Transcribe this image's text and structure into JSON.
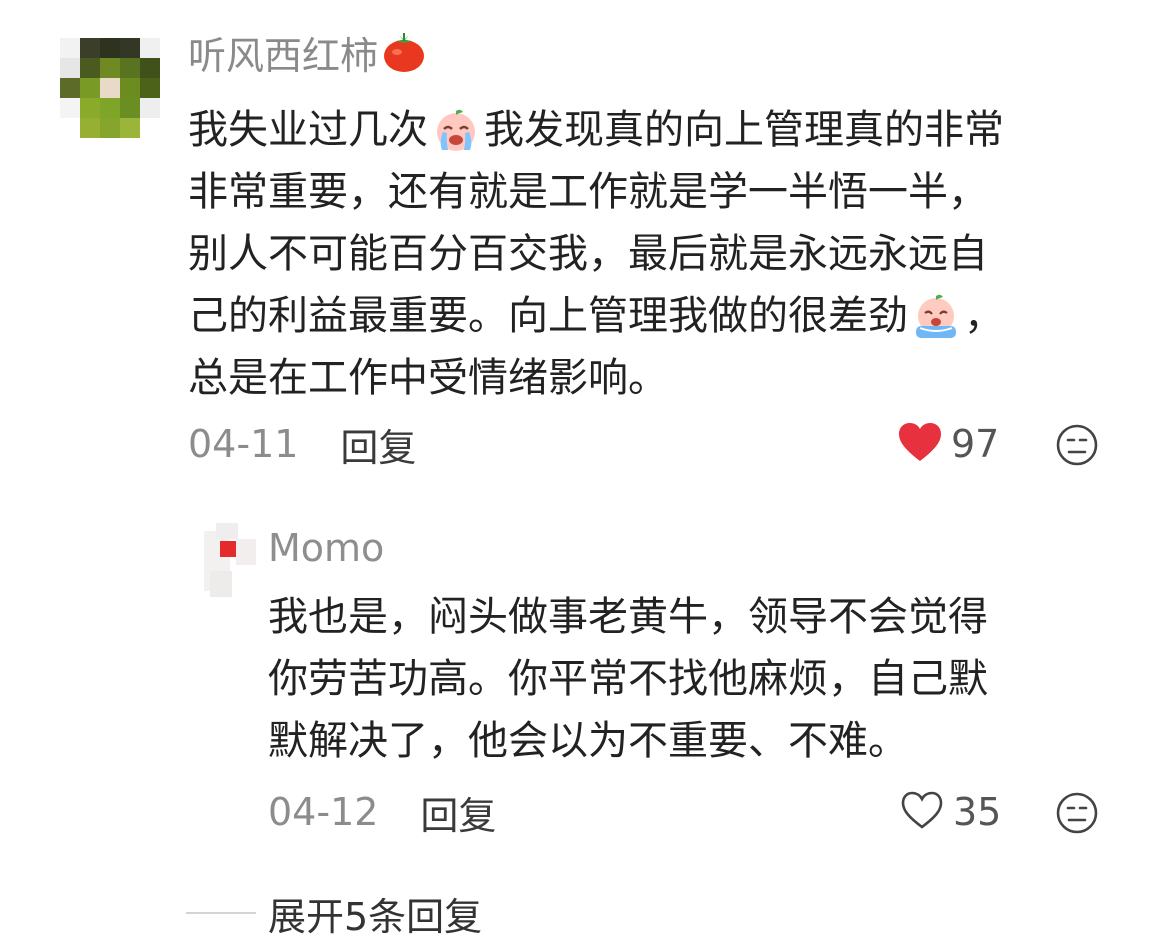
{
  "comment": {
    "username": "听风西红柿",
    "text_lines": [
      [
        "我失业过几次",
        "我发现真的向上管理真的非常"
      ],
      [
        "非常重要，还有就是工作就是学一半悟一半，"
      ],
      [
        "别人不可能百分百交我，最后就是永远永远自"
      ],
      [
        "己的利益最重要。向上管理我做的很差劲",
        "，"
      ],
      [
        "总是在工作中受情绪影响。"
      ]
    ],
    "date": "04-11",
    "reply_label": "回复",
    "like_count": "97",
    "colors": {
      "like_active": "#e8313e",
      "username": "#8a8a8a",
      "body": "#222222"
    }
  },
  "reply": {
    "username": "Momo",
    "text_lines": [
      "我也是，闷头做事老黄牛，领导不会觉得",
      "你劳苦功高。你平常不找他麻烦，自己默",
      "默解决了，他会以为不重要、不难。"
    ],
    "date": "04-12",
    "reply_label": "回复",
    "like_count": "35"
  },
  "expand_label": "展开5条回复"
}
